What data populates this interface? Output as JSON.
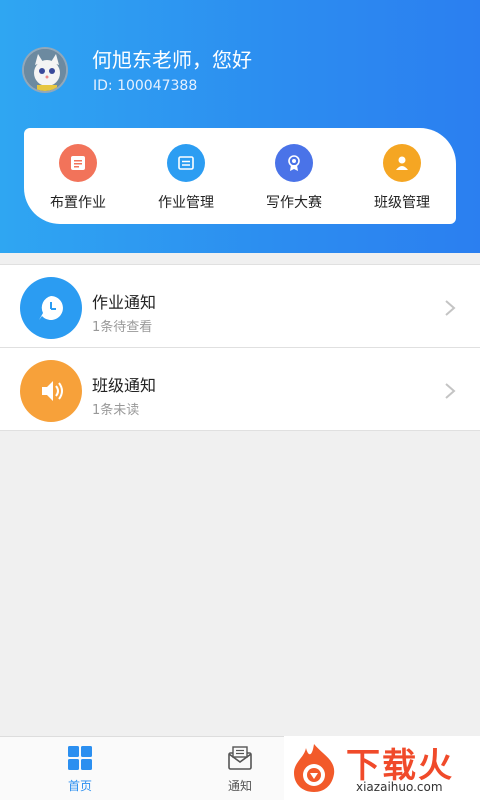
{
  "header": {
    "greeting": "何旭东老师，您好",
    "id_label": "ID: 100047388"
  },
  "quick_menu": [
    {
      "label": "布置作业",
      "icon": "assign-homework-icon",
      "color": "#f2735a"
    },
    {
      "label": "作业管理",
      "icon": "homework-manage-icon",
      "color": "#2c9df2"
    },
    {
      "label": "写作大赛",
      "icon": "writing-contest-icon",
      "color": "#4a73e8"
    },
    {
      "label": "班级管理",
      "icon": "class-manage-icon",
      "color": "#f5a623"
    }
  ],
  "notifications": [
    {
      "title": "作业通知",
      "subtitle": "1条待查看",
      "icon": "clock-icon",
      "color": "#2b9cf2"
    },
    {
      "title": "班级通知",
      "subtitle": "1条未读",
      "icon": "speaker-icon",
      "color": "#f7a13a"
    }
  ],
  "tabbar": {
    "home": "首页",
    "notice": "通知",
    "active_color": "#2b8ff0",
    "inactive_color": "#555555"
  },
  "watermark": {
    "brand": "下载火",
    "url": "xiazaihuo.com"
  }
}
